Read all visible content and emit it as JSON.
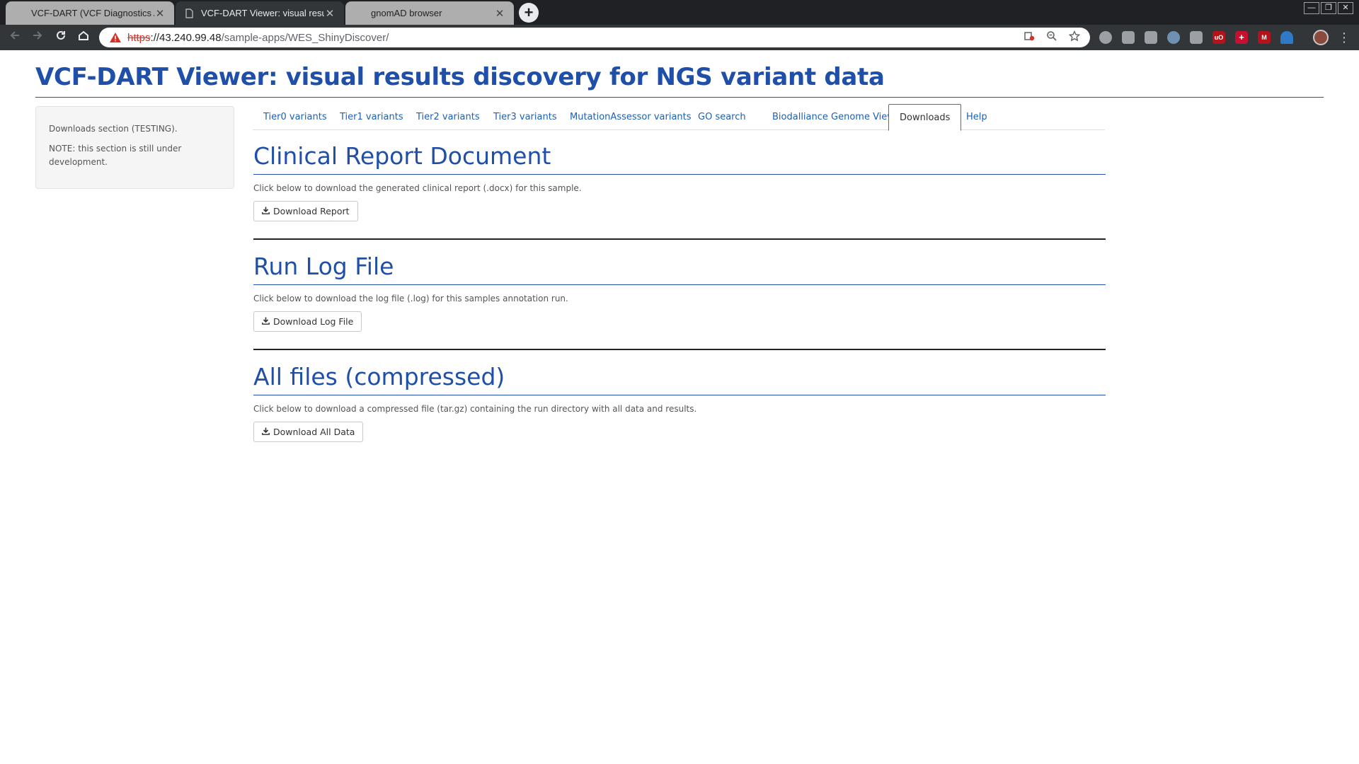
{
  "browser": {
    "tabs": [
      {
        "title": "VCF-DART (VCF Diagnostics Ann",
        "active": false
      },
      {
        "title": "VCF-DART Viewer: visual results",
        "active": true
      },
      {
        "title": "gnomAD browser",
        "active": false
      }
    ],
    "close_glyph": "✕",
    "new_tab_glyph": "+",
    "url": {
      "scheme": "https",
      "host": "://43.240.99.48",
      "path": "/sample-apps/WES_ShinyDiscover/"
    },
    "window_controls": [
      "—",
      "❐",
      "✕"
    ],
    "nav_icons": [
      "back-arrow-icon",
      "forward-arrow-icon",
      "reload-icon",
      "home-icon"
    ],
    "omnibox_icons": [
      "blocked-content-icon",
      "zoom-icon",
      "bookmark-star-icon"
    ],
    "extensions": [
      {
        "name": "speech-bubble-ext-icon",
        "color": "#9aa0a6",
        "label": ""
      },
      {
        "name": "cast-ext-icon",
        "color": "#9aa0a6",
        "label": ""
      },
      {
        "name": "shield-ext-icon",
        "color": "#9aa0a6",
        "label": ""
      },
      {
        "name": "people-ext-icon",
        "color": "#6f8fb3",
        "label": ""
      },
      {
        "name": "chat-ext-icon",
        "color": "#9aa0a6",
        "label": ""
      },
      {
        "name": "ublock-ext-icon",
        "color": "#b3141b",
        "label": "uO"
      },
      {
        "name": "plus-ext-icon",
        "color": "#c8102e",
        "label": "+"
      },
      {
        "name": "m-ext-icon",
        "color": "#b3141b",
        "label": "M"
      },
      {
        "name": "arc-ext-icon",
        "color": "#2f79c7",
        "label": ""
      }
    ]
  },
  "app": {
    "title": "VCF-DART Viewer: visual results discovery for NGS variant data",
    "sidebar": {
      "line1": "Downloads section (TESTING).",
      "line2": "NOTE: this section is still under development."
    },
    "tabs": [
      {
        "label": "Tier0 variants",
        "active": false
      },
      {
        "label": "Tier1 variants",
        "active": false
      },
      {
        "label": "Tier2 variants",
        "active": false
      },
      {
        "label": "Tier3 variants",
        "active": false
      },
      {
        "label": "MutationAssessor variants",
        "active": false
      },
      {
        "label": "GO search",
        "active": false
      },
      {
        "label": "Biodalliance Genome Viewer",
        "active": false
      },
      {
        "label": "Downloads",
        "active": true
      },
      {
        "label": "Help",
        "active": false
      }
    ],
    "sections": [
      {
        "heading": "Clinical Report Document",
        "description": "Click below to download the generated clinical report (.docx) for this sample.",
        "button": "Download Report"
      },
      {
        "heading": "Run Log File",
        "description": "Click below to download the log file (.log) for this samples annotation run.",
        "button": "Download Log File"
      },
      {
        "heading": "All files (compressed)",
        "description": "Click below to download a compressed file (tar.gz) containing the run directory with all data and results.",
        "button": "Download All Data"
      }
    ]
  }
}
